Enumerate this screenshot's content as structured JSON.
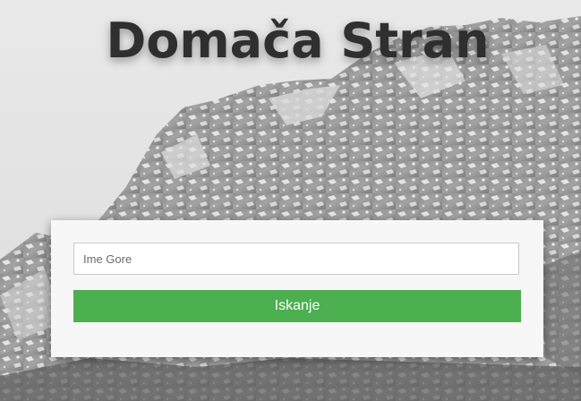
{
  "header": {
    "title": "Domača Stran"
  },
  "search": {
    "placeholder": "Ime Gore",
    "value": "",
    "button_label": "Iskanje"
  },
  "colors": {
    "button": "#4caf50",
    "title": "#2f2f2f",
    "card": "#f7f7f7"
  }
}
